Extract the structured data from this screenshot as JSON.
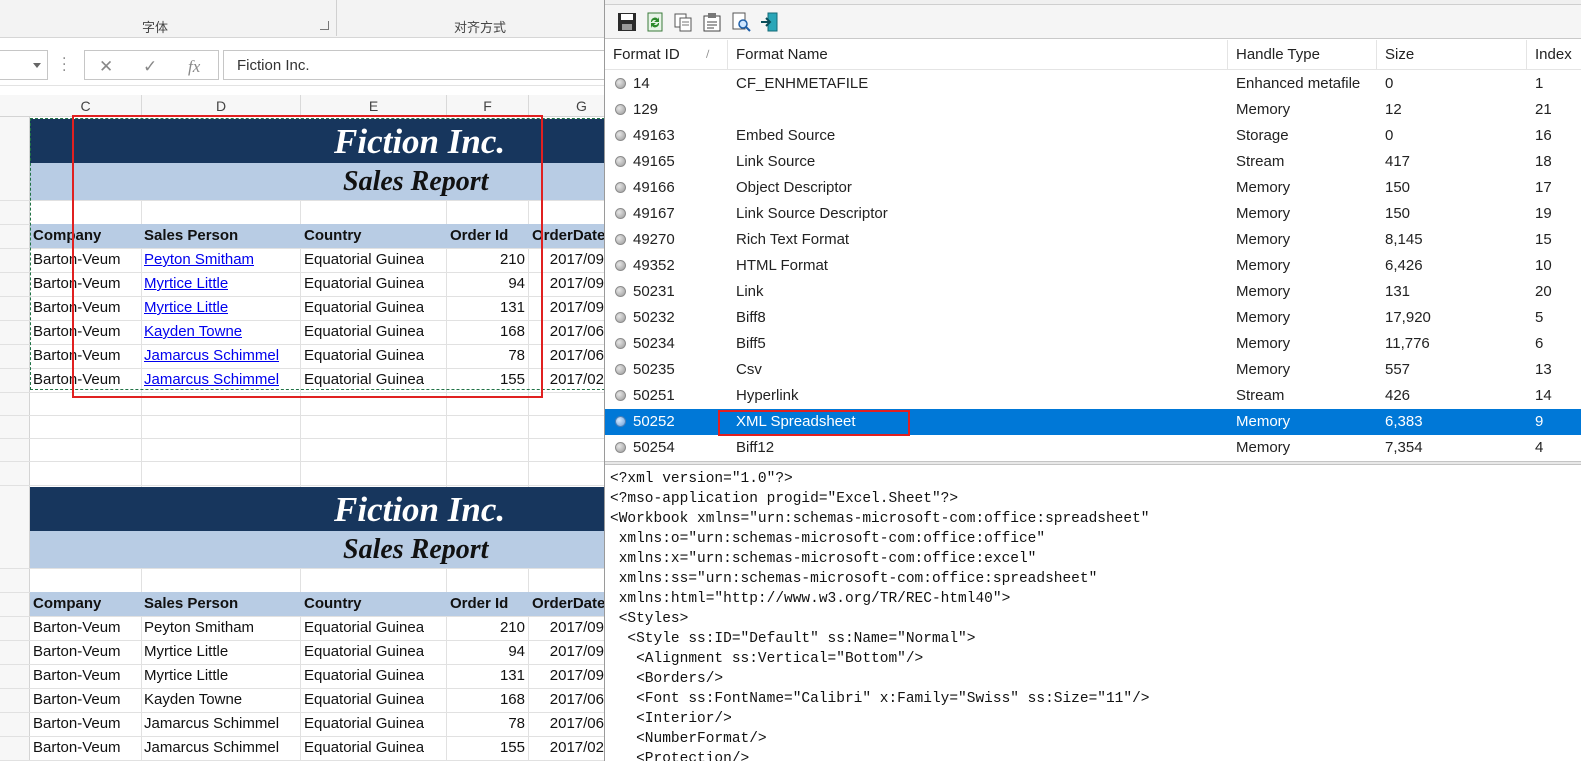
{
  "excel": {
    "ribbon": {
      "font_group": "字体",
      "alignment_group": "对齐方式"
    },
    "formula_bar": {
      "cancel_icon": "✕",
      "enter_icon": "✓",
      "fx_label": "fx",
      "value": "Fiction Inc."
    },
    "columns": [
      "C",
      "D",
      "E",
      "F",
      "G"
    ],
    "report_title": "Fiction Inc.",
    "report_subtitle": "Sales Report",
    "headers": [
      "Company",
      "Sales Person",
      "Country",
      "Order Id",
      "OrderDate"
    ],
    "rows_top": [
      {
        "company": "Barton-Veum",
        "person": "Peyton Smitham",
        "country": "Equatorial Guinea",
        "order": "210",
        "date": "2017/09"
      },
      {
        "company": "Barton-Veum",
        "person": "Myrtice Little",
        "country": "Equatorial Guinea",
        "order": "94",
        "date": "2017/09"
      },
      {
        "company": "Barton-Veum",
        "person": "Myrtice Little",
        "country": "Equatorial Guinea",
        "order": "131",
        "date": "2017/09"
      },
      {
        "company": "Barton-Veum",
        "person": "Kayden Towne",
        "country": "Equatorial Guinea",
        "order": "168",
        "date": "2017/06"
      },
      {
        "company": "Barton-Veum",
        "person": "Jamarcus Schimmel",
        "country": "Equatorial Guinea",
        "order": "78",
        "date": "2017/06"
      },
      {
        "company": "Barton-Veum",
        "person": "Jamarcus Schimmel",
        "country": "Equatorial Guinea",
        "order": "155",
        "date": "2017/02"
      }
    ],
    "rows_bottom": [
      {
        "company": "Barton-Veum",
        "person": "Peyton Smitham",
        "country": "Equatorial Guinea",
        "order": "210",
        "date": "2017/09"
      },
      {
        "company": "Barton-Veum",
        "person": "Myrtice Little",
        "country": "Equatorial Guinea",
        "order": "94",
        "date": "2017/09"
      },
      {
        "company": "Barton-Veum",
        "person": "Myrtice Little",
        "country": "Equatorial Guinea",
        "order": "131",
        "date": "2017/09"
      },
      {
        "company": "Barton-Veum",
        "person": "Kayden Towne",
        "country": "Equatorial Guinea",
        "order": "168",
        "date": "2017/06"
      },
      {
        "company": "Barton-Veum",
        "person": "Jamarcus Schimmel",
        "country": "Equatorial Guinea",
        "order": "78",
        "date": "2017/06"
      },
      {
        "company": "Barton-Veum",
        "person": "Jamarcus Schimmel",
        "country": "Equatorial Guinea",
        "order": "155",
        "date": "2017/02"
      }
    ]
  },
  "viewer": {
    "toolbar_icons": [
      "save-icon",
      "refresh-icon",
      "copy-icon",
      "properties-icon",
      "find-icon",
      "exit-icon"
    ],
    "columns": [
      "Format ID",
      "Format Name",
      "Handle Type",
      "Size",
      "Index"
    ],
    "formats": [
      {
        "id": "14",
        "name": "CF_ENHMETAFILE",
        "handle": "Enhanced metafile",
        "size": "0",
        "index": "1"
      },
      {
        "id": "129",
        "name": "",
        "handle": "Memory",
        "size": "12",
        "index": "21"
      },
      {
        "id": "49163",
        "name": "Embed Source",
        "handle": "Storage",
        "size": "0",
        "index": "16"
      },
      {
        "id": "49165",
        "name": "Link Source",
        "handle": "Stream",
        "size": "417",
        "index": "18"
      },
      {
        "id": "49166",
        "name": "Object Descriptor",
        "handle": "Memory",
        "size": "150",
        "index": "17"
      },
      {
        "id": "49167",
        "name": "Link Source Descriptor",
        "handle": "Memory",
        "size": "150",
        "index": "19"
      },
      {
        "id": "49270",
        "name": "Rich Text Format",
        "handle": "Memory",
        "size": "8,145",
        "index": "15"
      },
      {
        "id": "49352",
        "name": "HTML Format",
        "handle": "Memory",
        "size": "6,426",
        "index": "10"
      },
      {
        "id": "50231",
        "name": "Link",
        "handle": "Memory",
        "size": "131",
        "index": "20"
      },
      {
        "id": "50232",
        "name": "Biff8",
        "handle": "Memory",
        "size": "17,920",
        "index": "5"
      },
      {
        "id": "50234",
        "name": "Biff5",
        "handle": "Memory",
        "size": "11,776",
        "index": "6"
      },
      {
        "id": "50235",
        "name": "Csv",
        "handle": "Memory",
        "size": "557",
        "index": "13"
      },
      {
        "id": "50251",
        "name": "Hyperlink",
        "handle": "Stream",
        "size": "426",
        "index": "14"
      },
      {
        "id": "50252",
        "name": "XML Spreadsheet",
        "handle": "Memory",
        "size": "6,383",
        "index": "9",
        "selected": true
      },
      {
        "id": "50254",
        "name": "Biff12",
        "handle": "Memory",
        "size": "7,354",
        "index": "4"
      }
    ],
    "xml_lines": [
      "<?xml version=\"1.0\"?>",
      "<?mso-application progid=\"Excel.Sheet\"?>",
      "<Workbook xmlns=\"urn:schemas-microsoft-com:office:spreadsheet\"",
      " xmlns:o=\"urn:schemas-microsoft-com:office:office\"",
      " xmlns:x=\"urn:schemas-microsoft-com:office:excel\"",
      " xmlns:ss=\"urn:schemas-microsoft-com:office:spreadsheet\"",
      " xmlns:html=\"http://www.w3.org/TR/REC-html40\">",
      " <Styles>",
      "  <Style ss:ID=\"Default\" ss:Name=\"Normal\">",
      "   <Alignment ss:Vertical=\"Bottom\"/>",
      "   <Borders/>",
      "   <Font ss:FontName=\"Calibri\" x:Family=\"Swiss\" ss:Size=\"11\"/>",
      "   <Interior/>",
      "   <NumberFormat/>",
      "   <Protection/>"
    ]
  },
  "colors": {
    "title_band": "#17365d",
    "sub_band": "#b8cce4",
    "selection": "#0078d7",
    "highlight_box": "#e02020",
    "link": "#0000ee"
  }
}
